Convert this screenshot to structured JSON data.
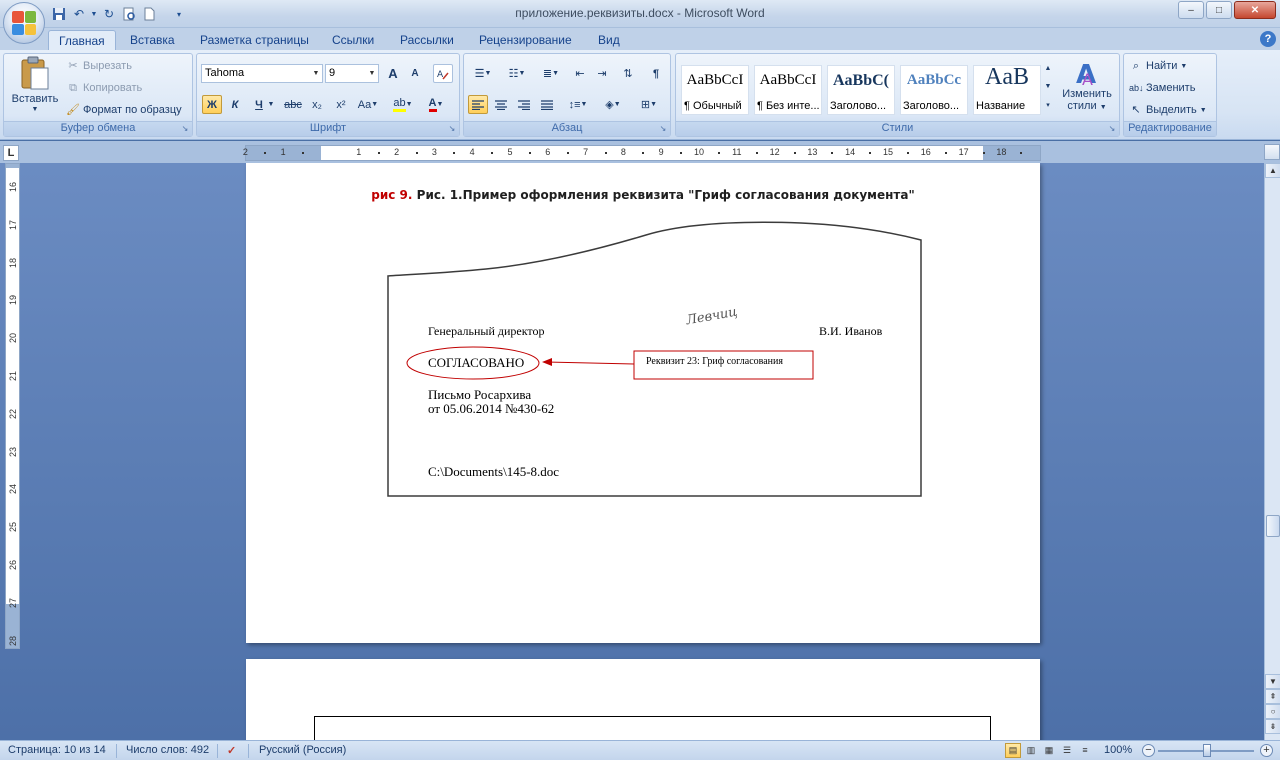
{
  "window": {
    "title": "приложение.реквизиты.docx - Microsoft Word",
    "minimize": "–",
    "maximize": "□",
    "close": "✕"
  },
  "quick_access": [
    "save-icon",
    "undo-icon",
    "redo-icon",
    "print-preview-icon",
    "new-document-icon",
    "customize-icon"
  ],
  "tabs": [
    "Главная",
    "Вставка",
    "Разметка страницы",
    "Ссылки",
    "Рассылки",
    "Рецензирование",
    "Вид"
  ],
  "active_tab": "Главная",
  "ribbon": {
    "clipboard": {
      "label": "Буфер обмена",
      "paste": "Вставить",
      "cut": "Вырезать",
      "copy": "Копировать",
      "format_painter": "Формат по образцу"
    },
    "font": {
      "label": "Шрифт",
      "font_name": "Tahoma",
      "font_size": "9",
      "bold": "Ж",
      "italic": "К",
      "underline": "Ч",
      "strike": "abc",
      "subscript": "x₂",
      "superscript": "x²",
      "change_case": "Aa",
      "grow": "A",
      "shrink": "A",
      "font_color_accent": "#e00000",
      "highlight_accent": "#ffff00"
    },
    "paragraph": {
      "label": "Абзац",
      "show_marks": "¶"
    },
    "styles": {
      "label": "Стили",
      "items": [
        {
          "sample": "AaBbCcI",
          "name": "¶ Обычный"
        },
        {
          "sample": "AaBbCcI",
          "name": "¶ Без инте..."
        },
        {
          "sample": "AaBbC(",
          "name": "Заголово..."
        },
        {
          "sample": "AaBbCc",
          "name": "Заголово..."
        },
        {
          "sample": "AaB",
          "name": "Название"
        }
      ],
      "change_styles_line1": "Изменить",
      "change_styles_line2": "стили"
    },
    "editing": {
      "label": "Редактирование",
      "find": "Найти",
      "replace": "Заменить",
      "select": "Выделить"
    }
  },
  "ruler": {
    "horizontal_numbers": [
      "2",
      "1",
      "1",
      "2",
      "3",
      "4",
      "5",
      "6",
      "7",
      "8",
      "9",
      "10",
      "11",
      "12",
      "13",
      "14",
      "15",
      "16",
      "17",
      "18"
    ],
    "vertical_numbers": [
      "16",
      "17",
      "18",
      "19",
      "20",
      "21",
      "22",
      "23",
      "24",
      "25",
      "26",
      "27",
      "28"
    ]
  },
  "document": {
    "caption_prefix": "рис 9.",
    "caption_text": " Рис. 1.Пример оформления реквизита \"Гриф согласования документа\"",
    "figure": {
      "position": "Генеральный директор",
      "signature": "Левчиц",
      "signer": "В.И. Иванов",
      "approval_stamp": "СОГЛАСОВАНО",
      "callout": "Реквизит 23: Гриф согласования",
      "basis_line1": "Письмо Росархива",
      "basis_line2": "от 05.06.2014 №430-62",
      "file_path": "C:\\Documents\\145-8.doc"
    },
    "accent_colors": {
      "ellipse": "#c00000",
      "arrow": "#c00000",
      "caption_prefix": "#c00000"
    }
  },
  "statusbar": {
    "page": "Страница: 10 из 14",
    "words": "Число слов: 492",
    "language": "Русский (Россия)",
    "zoom": "100%",
    "zoom_out": "−",
    "zoom_in": "+"
  }
}
